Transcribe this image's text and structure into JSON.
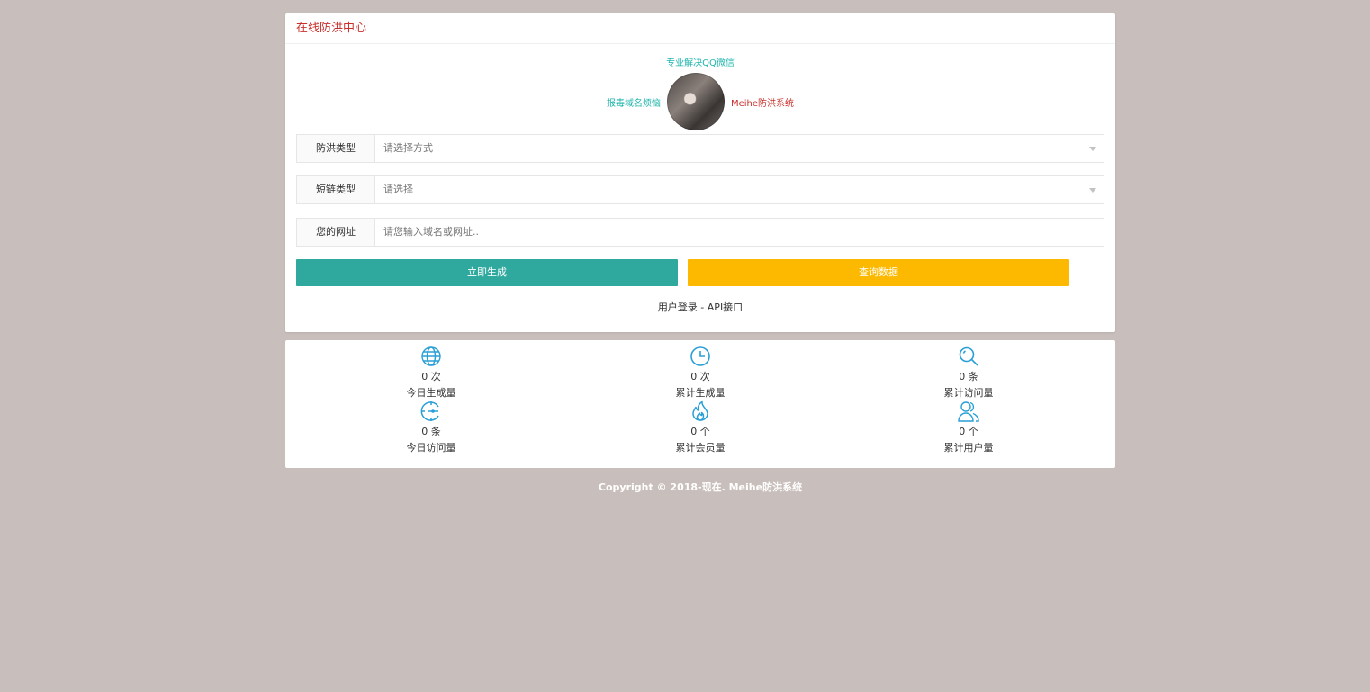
{
  "header": {
    "title": "在线防洪中心"
  },
  "promo": {
    "top": "专业解决QQ微信",
    "left": "报毒域名烦恼",
    "right": "Meihe防洪系统"
  },
  "form": {
    "type_label": "防洪类型",
    "type_placeholder": "请选择方式",
    "short_label": "短链类型",
    "short_placeholder": "请选择",
    "url_label": "您的网址",
    "url_placeholder": "请您输入域名或网址.."
  },
  "buttons": {
    "generate": "立即生成",
    "query": "查询数据"
  },
  "links": {
    "login": "用户登录",
    "separator": " - ",
    "api": "API接口"
  },
  "stats": [
    {
      "icon": "globe-icon",
      "value": "0 次",
      "label": "今日生成量"
    },
    {
      "icon": "clock-icon",
      "value": "0 次",
      "label": "累计生成量"
    },
    {
      "icon": "search-icon",
      "value": "0 条",
      "label": "累计访问量"
    },
    {
      "icon": "target-icon",
      "value": "0 条",
      "label": "今日访问量"
    },
    {
      "icon": "fire-icon",
      "value": "0 个",
      "label": "累计会员量"
    },
    {
      "icon": "users-icon",
      "value": "0 个",
      "label": "累计用户量"
    }
  ],
  "footer": {
    "text": "Copyright © 2018-现在. Meihe防洪系统"
  },
  "colors": {
    "accent_teal": "#2fa89e",
    "accent_yellow": "#fdb900",
    "header_red": "#c9302c",
    "icon_blue": "#2a9fd6"
  }
}
